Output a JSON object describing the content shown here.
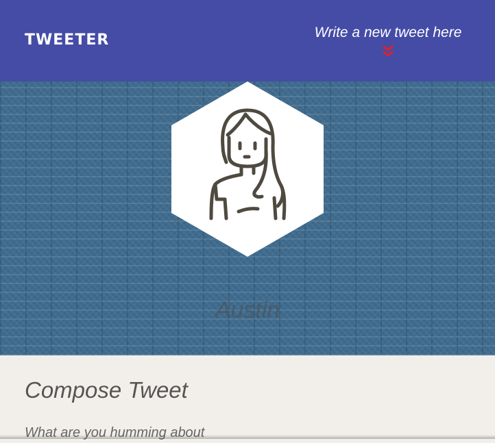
{
  "navbar": {
    "brand": "TWEETER",
    "compose_link": "Write a new tweet here",
    "compose_icon": "double-chevron-down-icon",
    "background_color": "#454ca6",
    "icon_color": "#e0202a"
  },
  "profile": {
    "username": "Austin",
    "avatar_icon": "person-avatar-icon",
    "banner_color": "#3f6b8e"
  },
  "compose": {
    "title": "Compose Tweet",
    "placeholder": "What are you humming about"
  }
}
